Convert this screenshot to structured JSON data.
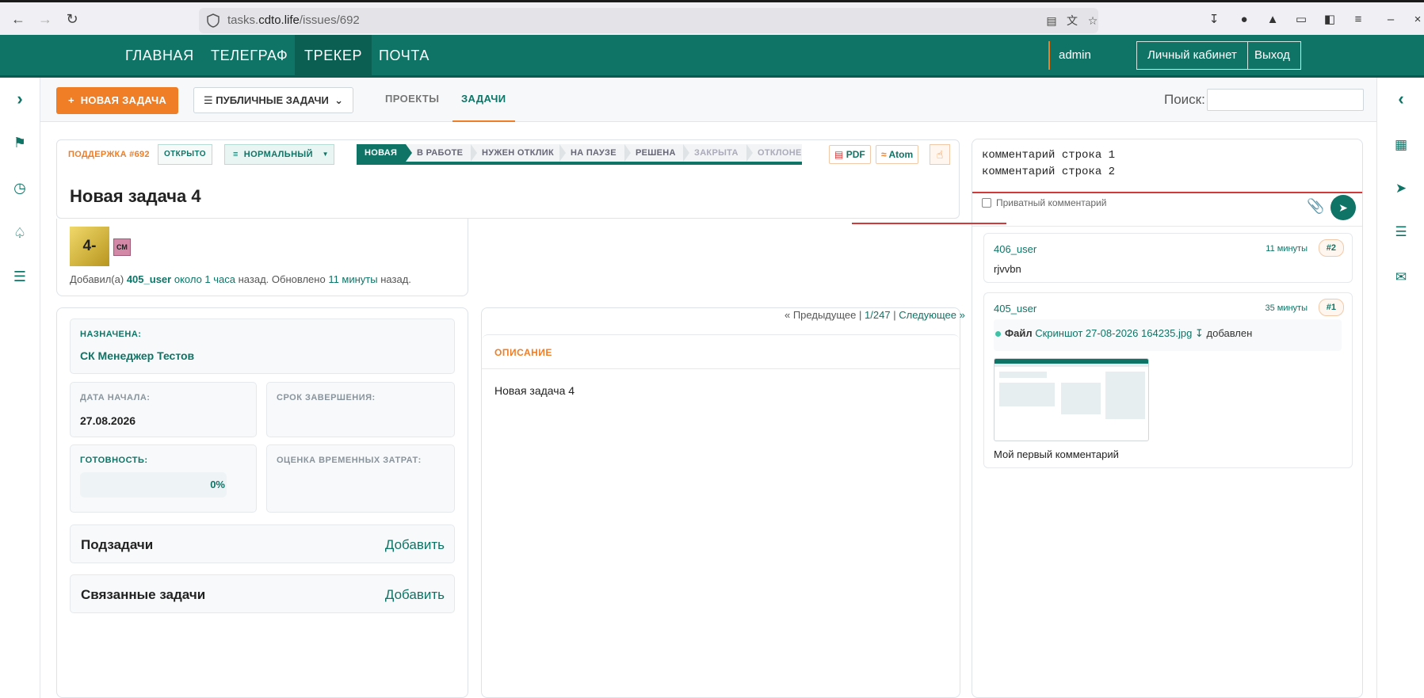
{
  "browser": {
    "url_prefix": "tasks.",
    "url_domain": "cdto.life",
    "url_path": "/issues/692"
  },
  "topnav": {
    "items": [
      "ГЛАВНАЯ",
      "ТЕЛЕГРАФ",
      "ТРЕКЕР",
      "ПОЧТА"
    ],
    "user": "admin",
    "cabinet": "Личный кабинет",
    "logout": "Выход"
  },
  "toolbar": {
    "new_task": "НОВАЯ ЗАДАЧА",
    "filter": "ПУБЛИЧНЫЕ ЗАДАЧИ",
    "tabs": [
      "ПРОЕКТЫ",
      "ЗАДАЧИ"
    ],
    "search_label": "Поиск:",
    "search_value": ""
  },
  "issue": {
    "tracker_id": "ПОДДЕРЖКА #692",
    "status": "ОТКРЫТО",
    "priority": "НОРМАЛЬНЫЙ",
    "workflow": [
      "НОВАЯ",
      "В РАБОТЕ",
      "НУЖЕН ОТКЛИК",
      "НА ПАУЗЕ",
      "РЕШЕНА",
      "ЗАКРЫТА",
      "ОТКЛОНЕНА"
    ],
    "export_pdf": "PDF",
    "export_atom": "Atom",
    "title": "Новая задача 4",
    "avatar_text": "4-",
    "mini_avatar": "СМ",
    "added_prefix": "Добавил(а)",
    "added_user": "405_user",
    "added_time": "около 1 часа",
    "added_mid": "назад. Обновлено",
    "updated_time": "11 минуты",
    "added_suffix": "назад."
  },
  "attributes": {
    "assigned_label": "НАЗНАЧЕНА:",
    "assigned_value": "СК Менеджер Тестов",
    "start_label": "ДАТА НАЧАЛА:",
    "start_value": "27.08.2026",
    "due_label": "СРОК ЗАВЕРШЕНИЯ:",
    "done_label": "ГОТОВНОСТЬ:",
    "done_value": "0%",
    "estimate_label": "ОЦЕНКА ВРЕМЕННЫХ ЗАТРАТ:",
    "subtasks": "Подзадачи",
    "related": "Связанные задачи",
    "add": "Добавить"
  },
  "pager": {
    "prev": "« Предыдущее",
    "sep": "|",
    "position": "1/247",
    "next": "Следующее »"
  },
  "description": {
    "heading": "ОПИСАНИЕ",
    "text": "Новая задача 4"
  },
  "comment_form": {
    "text": "комментарий строка 1\nкомментарий строка 2",
    "private_label": "Приватный комментарий"
  },
  "comments": [
    {
      "author": "406_user",
      "time": "11 минуты",
      "num": "#2",
      "body": "rjvvbn"
    },
    {
      "author": "405_user",
      "time": "35 минуты",
      "num": "#1",
      "file_label": "Файл",
      "file_name": "Скриншот 27-08-2026 164235.jpg",
      "file_suffix": "добавлен",
      "body": "Мой первый комментарий"
    }
  ],
  "colors": {
    "brand_green": "#0f7466",
    "accent_orange": "#f07e26",
    "alert_red": "#d23a3a"
  }
}
